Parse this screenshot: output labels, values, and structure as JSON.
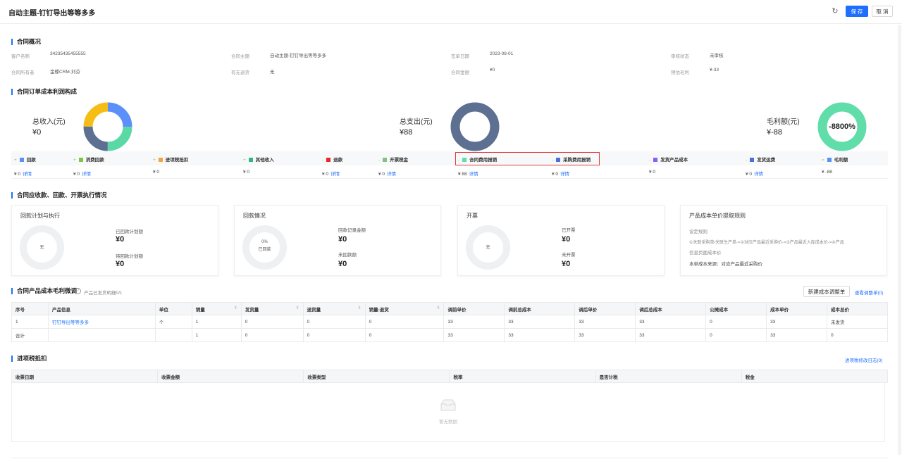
{
  "header": {
    "title": "自动主题-钉钉导出等等多多",
    "save": "保 存",
    "cancel": "取 消"
  },
  "overview": {
    "title": "合同概况",
    "fields": [
      {
        "label": "客户名称",
        "value": "34235435455555"
      },
      {
        "label": "合同主题",
        "value": "自动主题-钉钉导出等等多多"
      },
      {
        "label": "签单日期",
        "value": "2023-08-01"
      },
      {
        "label": "审核状态",
        "value": "未审核"
      },
      {
        "label": "合同所有者",
        "value": "金蝶CRM-刘芬"
      },
      {
        "label": "有无退货",
        "value": "无"
      },
      {
        "label": "合同金额",
        "value": "¥0"
      },
      {
        "label": "预估毛利",
        "value": "¥-33"
      }
    ]
  },
  "composition": {
    "title": "合同订单成本利润构成",
    "income_label": "总收入(元)",
    "income_value": "¥0",
    "expense_label": "总支出(元)",
    "expense_value": "¥88",
    "profit_label": "毛利额(元)",
    "profit_value": "¥-88",
    "profit_rate": "-8800%",
    "colors": {
      "blue": "#5b8ff9",
      "green": "#5ad8a6",
      "yellow": "#f6bd16",
      "slate": "#5d7092",
      "teal": "#61ddaa"
    },
    "legend": [
      {
        "sign": "+",
        "name": "回款",
        "color": "#5b8ff9",
        "value": "¥ 0",
        "detail": "详情"
      },
      {
        "sign": "+",
        "name": "消费回款",
        "color": "#7bc63f",
        "value": "¥ 0",
        "detail": "详情"
      },
      {
        "sign": "+",
        "name": "进项税抵扣",
        "color": "#f6a13d",
        "value": "¥ 0",
        "detail": ""
      },
      {
        "sign": "+",
        "name": "其他收入",
        "color": "#36b37e",
        "value": "¥ 0",
        "detail": ""
      },
      {
        "sign": "-",
        "name": "退款",
        "color": "#e8272b",
        "value": "¥ 0",
        "detail": "详情"
      },
      {
        "sign": "-",
        "name": "开票税金",
        "color": "#7ec27e",
        "value": "¥ 0",
        "detail": "详情"
      },
      {
        "sign": "-",
        "name": "合同费用报销",
        "color": "#61ddaa",
        "value": "¥ 88",
        "detail": "详情"
      },
      {
        "sign": "-",
        "name": "采购费用报销",
        "color": "#4a6fd8",
        "value": "¥ 0",
        "detail": "详情"
      },
      {
        "sign": "-",
        "name": "发货产品成本",
        "color": "#8b5cf6",
        "value": "¥ 0",
        "detail": ""
      },
      {
        "sign": "-",
        "name": "发货运费",
        "color": "#4a6fd8",
        "value": "¥ 0",
        "detail": "详情"
      },
      {
        "sign": "=",
        "name": "毛利额",
        "color": "#5b8ff9",
        "value": "¥ -88",
        "detail": ""
      }
    ]
  },
  "execution": {
    "title": "合同应收款、回款、开票执行情况",
    "plan": {
      "title": "回款计划与执行",
      "donut": "无",
      "l1": "已回款计划额",
      "v1": "¥0",
      "l2": "待回款计划额",
      "v2": "¥0"
    },
    "receipt": {
      "title": "回款情况",
      "donut_pct": "0%",
      "donut_lbl": "已回款",
      "l1": "回款记录金额",
      "v1": "¥0",
      "l2": "未回款额",
      "v2": "¥0"
    },
    "invoice": {
      "title": "开票",
      "donut": "无",
      "l1": "已开票",
      "v1": "¥0",
      "l2": "未开票",
      "v2": "¥0"
    },
    "rule": {
      "title": "产品成本单价提取规则",
      "l1": "设定规则",
      "l2": "①关联采购单/关联生产单->②对应产品最近采购价->③产品最近入库成本价->④产品",
      "l3": "信息页面成本价",
      "l4": "本单成本来源：对应产品最近采购价"
    }
  },
  "products": {
    "title": "合同产品成本毛利微调",
    "help": "?",
    "sub": "产品已发货明细0/1",
    "new_btn": "新建成本调整单",
    "view_link": "查看调整单(0)",
    "columns": [
      "序号",
      "产品信息",
      "单位",
      "销量",
      "发货量",
      "退货量",
      "销量-退货",
      "调前单价",
      "调前总成本",
      "调后单价",
      "调后总成本",
      "公摊成本",
      "成本单价",
      "成本总价"
    ],
    "rows": [
      [
        "1",
        "钉钉导出等等多多",
        "个",
        "1",
        "0",
        "0",
        "0",
        "33",
        "33",
        "33",
        "33",
        "0",
        "33",
        "未发货"
      ],
      [
        "合计",
        "",
        "",
        "1",
        "0",
        "0",
        "0",
        "33",
        "33",
        "33",
        "33",
        "0",
        "33",
        "0"
      ]
    ]
  },
  "tax": {
    "title": "进项税抵扣",
    "log_link": "进项税修改日志(0)",
    "columns": [
      "收票日期",
      "收票金额",
      "收票类型",
      "税率",
      "是否计税",
      "税金"
    ],
    "empty": "暂无数据"
  }
}
